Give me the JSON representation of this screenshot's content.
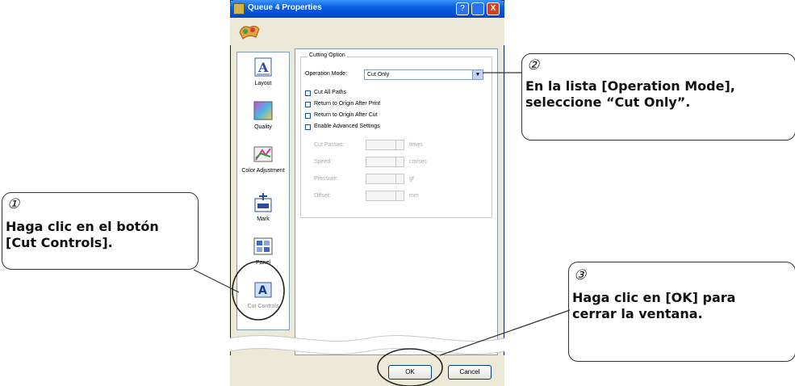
{
  "window": {
    "title": "Queue 4 Properties",
    "help_symbol": "?",
    "close_symbol": "X"
  },
  "sidebar": {
    "items": [
      {
        "label": "Layout"
      },
      {
        "label": "Quality"
      },
      {
        "label": "Color Adjustment"
      },
      {
        "label": "Mark"
      },
      {
        "label": "Panel"
      },
      {
        "label": "Cut Controls"
      }
    ]
  },
  "cutting": {
    "group_title": "Cutting Option",
    "operation_mode_label": "Operation Mode:",
    "operation_mode_value": "Cut Only",
    "checkboxes": [
      {
        "label": "Cut All Paths"
      },
      {
        "label": "Return to Origin After Print"
      },
      {
        "label": "Return to Origin After Cut"
      },
      {
        "label": "Enable Advanced Settings"
      }
    ],
    "advanced": [
      {
        "label": "Cut Passes:",
        "unit": "times"
      },
      {
        "label": "Speed:",
        "unit": "cm/sec"
      },
      {
        "label": "Pressure:",
        "unit": "gf"
      },
      {
        "label": "Offset:",
        "unit": "mm"
      }
    ]
  },
  "buttons": {
    "ok": "OK",
    "cancel": "Cancel"
  },
  "callouts": {
    "one": {
      "number": "①",
      "line1": "Haga clic en el botón",
      "line2": "[Cut Controls]."
    },
    "two": {
      "number": "②",
      "line1": "En la lista [Operation Mode],",
      "line2": "seleccione “Cut Only”."
    },
    "three": {
      "number": "③",
      "line1": "Haga clic en [OK] para",
      "line2": "cerrar la ventana."
    }
  },
  "colors": {
    "titlebar": "#0a5fe0",
    "dialog_bg": "#ece9d8",
    "close_button": "#d9411e"
  }
}
